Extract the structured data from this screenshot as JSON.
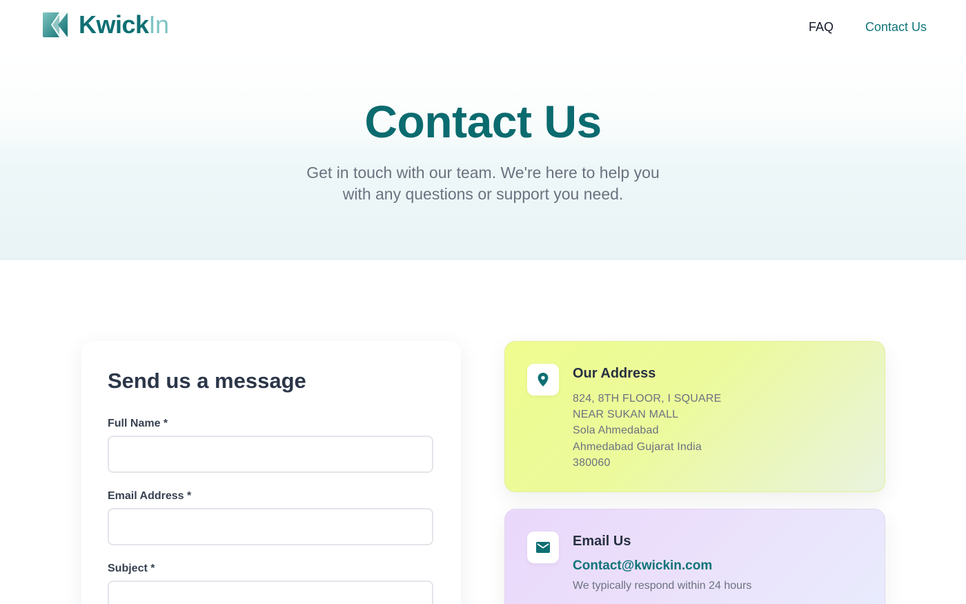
{
  "header": {
    "brand_bold": "Kwick",
    "brand_light": "In",
    "nav": {
      "faq": "FAQ",
      "contact": "Contact Us"
    }
  },
  "hero": {
    "title": "Contact Us",
    "subtitle_line1": "Get in touch with our team. We're here to help you",
    "subtitle_line2": "with any questions or support you need."
  },
  "form": {
    "title": "Send us a message",
    "fields": [
      {
        "label": "Full Name *",
        "value": "",
        "placeholder": ""
      },
      {
        "label": "Email Address *",
        "value": "",
        "placeholder": ""
      },
      {
        "label": "Subject *",
        "value": "",
        "placeholder": ""
      }
    ]
  },
  "address_card": {
    "title": "Our Address",
    "icon": "location-pin-icon",
    "lines": [
      "824, 8TH FLOOR, I SQUARE",
      "NEAR SUKAN MALL",
      "Sola Ahmedabad",
      "Ahmedabad Gujarat India",
      "380060"
    ]
  },
  "email_card": {
    "title": "Email Us",
    "icon": "mail-icon",
    "email": "Contact@kwickin.com",
    "note": "We typically respond within 24 hours"
  },
  "colors": {
    "brand_teal": "#0f6f73",
    "brand_teal_light": "#7fc4c4",
    "address_card_bg": "#eefc8f",
    "email_card_bg": "#ead7fb",
    "heading_dark": "#2b3648",
    "muted_text": "#6b7280"
  }
}
